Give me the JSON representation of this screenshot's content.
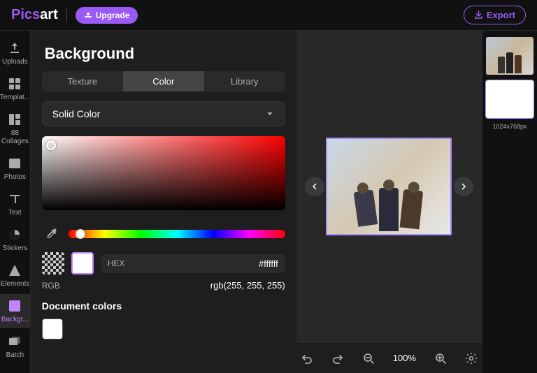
{
  "header": {
    "logo_text": "Picsart",
    "upgrade_label": "Upgrade",
    "export_label": "Export"
  },
  "sidebar": {
    "items": [
      {
        "id": "uploads",
        "label": "Uploads",
        "icon": "upload"
      },
      {
        "id": "templates",
        "label": "Templat...",
        "icon": "template"
      },
      {
        "id": "collages",
        "label": "Collages",
        "icon": "collages",
        "badge": "88"
      },
      {
        "id": "photos",
        "label": "Photos",
        "icon": "photos"
      },
      {
        "id": "text",
        "label": "Text",
        "icon": "text"
      },
      {
        "id": "stickers",
        "label": "Stickers",
        "icon": "stickers"
      },
      {
        "id": "elements",
        "label": "Elements",
        "icon": "elements"
      },
      {
        "id": "background",
        "label": "Backgr...",
        "icon": "background",
        "active": true
      },
      {
        "id": "batch",
        "label": "Batch",
        "icon": "batch"
      }
    ]
  },
  "panel": {
    "title": "Background",
    "tabs": [
      {
        "id": "texture",
        "label": "Texture"
      },
      {
        "id": "color",
        "label": "Color",
        "active": true
      },
      {
        "id": "library",
        "label": "Library"
      }
    ],
    "dropdown_label": "Solid Color",
    "hex_label": "HEX",
    "hex_value": "#ffffff",
    "rgb_label": "RGB",
    "rgb_value": "rgb(255, 255, 255)",
    "doc_colors_title": "Document colors"
  },
  "canvas": {
    "zoom_value": "100%"
  },
  "toolbar": {
    "undo_label": "undo",
    "redo_label": "redo",
    "zoom_out_label": "zoom-out",
    "zoom_value": "100%",
    "zoom_in_label": "zoom-in",
    "settings_label": "settings"
  },
  "thumbnails": [
    {
      "id": "thumb1",
      "type": "photo",
      "selected": false
    },
    {
      "id": "thumb2",
      "type": "white",
      "selected": true,
      "label": "1024x768px"
    }
  ]
}
